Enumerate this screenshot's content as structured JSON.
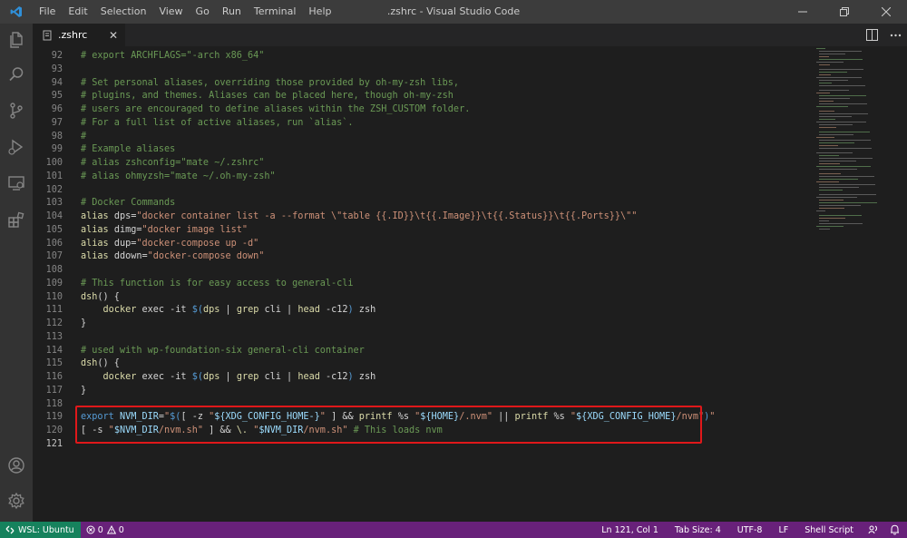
{
  "titlebar": {
    "menu": [
      "File",
      "Edit",
      "Selection",
      "View",
      "Go",
      "Run",
      "Terminal",
      "Help"
    ],
    "title": ".zshrc - Visual Studio Code"
  },
  "activity_icons": [
    "files-icon",
    "search-icon",
    "source-control-icon",
    "run-debug-icon",
    "remote-explorer-icon",
    "extensions-icon",
    "account-icon",
    "settings-gear-icon"
  ],
  "tab": {
    "label": ".zshrc"
  },
  "code": {
    "lines": [
      {
        "n": "92",
        "tokens": [
          {
            "t": "# export ARCHFLAGS=\"-arch x86_64\"",
            "c": "comment"
          }
        ]
      },
      {
        "n": "93",
        "tokens": []
      },
      {
        "n": "94",
        "tokens": [
          {
            "t": "# Set personal aliases, overriding those provided by oh-my-zsh libs,",
            "c": "comment"
          }
        ]
      },
      {
        "n": "95",
        "tokens": [
          {
            "t": "# plugins, and themes. Aliases can be placed here, though oh-my-zsh",
            "c": "comment"
          }
        ]
      },
      {
        "n": "96",
        "tokens": [
          {
            "t": "# users are encouraged to define aliases within the ZSH_CUSTOM folder.",
            "c": "comment"
          }
        ]
      },
      {
        "n": "97",
        "tokens": [
          {
            "t": "# For a full list of active aliases, run `alias`.",
            "c": "comment"
          }
        ]
      },
      {
        "n": "98",
        "tokens": [
          {
            "t": "#",
            "c": "comment"
          }
        ]
      },
      {
        "n": "99",
        "tokens": [
          {
            "t": "# Example aliases",
            "c": "comment"
          }
        ]
      },
      {
        "n": "100",
        "tokens": [
          {
            "t": "# alias zshconfig=\"mate ~/.zshrc\"",
            "c": "comment"
          }
        ]
      },
      {
        "n": "101",
        "tokens": [
          {
            "t": "# alias ohmyzsh=\"mate ~/.oh-my-zsh\"",
            "c": "comment"
          }
        ]
      },
      {
        "n": "102",
        "tokens": []
      },
      {
        "n": "103",
        "tokens": [
          {
            "t": "# Docker Commands",
            "c": "comment"
          }
        ]
      },
      {
        "n": "104",
        "tokens": [
          {
            "t": "alias ",
            "c": "func"
          },
          {
            "t": "dps",
            "c": "plain"
          },
          {
            "t": "=",
            "c": "op"
          },
          {
            "t": "\"docker container list -a --format \\\"table {{.ID}}\\t{{.Image}}\\t{{.Status}}\\t{{.Ports}}\\\"\"",
            "c": "str"
          }
        ]
      },
      {
        "n": "105",
        "tokens": [
          {
            "t": "alias ",
            "c": "func"
          },
          {
            "t": "dimg",
            "c": "plain"
          },
          {
            "t": "=",
            "c": "op"
          },
          {
            "t": "\"docker image list\"",
            "c": "str"
          }
        ]
      },
      {
        "n": "106",
        "tokens": [
          {
            "t": "alias ",
            "c": "func"
          },
          {
            "t": "dup",
            "c": "plain"
          },
          {
            "t": "=",
            "c": "op"
          },
          {
            "t": "\"docker-compose up -d\"",
            "c": "str"
          }
        ]
      },
      {
        "n": "107",
        "tokens": [
          {
            "t": "alias ",
            "c": "func"
          },
          {
            "t": "ddown",
            "c": "plain"
          },
          {
            "t": "=",
            "c": "op"
          },
          {
            "t": "\"docker-compose down\"",
            "c": "str"
          }
        ]
      },
      {
        "n": "108",
        "tokens": []
      },
      {
        "n": "109",
        "tokens": [
          {
            "t": "# This function is for easy access to general-cli",
            "c": "comment"
          }
        ]
      },
      {
        "n": "110",
        "tokens": [
          {
            "t": "dsh",
            "c": "func"
          },
          {
            "t": "() {",
            "c": "plain"
          }
        ]
      },
      {
        "n": "111",
        "tokens": [
          {
            "t": "    ",
            "c": "plain"
          },
          {
            "t": "docker",
            "c": "func"
          },
          {
            "t": " exec -it ",
            "c": "plain"
          },
          {
            "t": "$(",
            "c": "kw"
          },
          {
            "t": "dps ",
            "c": "func"
          },
          {
            "t": "| ",
            "c": "plain"
          },
          {
            "t": "grep",
            "c": "func"
          },
          {
            "t": " cli ",
            "c": "plain"
          },
          {
            "t": "| ",
            "c": "plain"
          },
          {
            "t": "head",
            "c": "func"
          },
          {
            "t": " -c12",
            "c": "plain"
          },
          {
            "t": ")",
            "c": "kw"
          },
          {
            "t": " zsh",
            "c": "plain"
          }
        ]
      },
      {
        "n": "112",
        "tokens": [
          {
            "t": "}",
            "c": "plain"
          }
        ]
      },
      {
        "n": "113",
        "tokens": []
      },
      {
        "n": "114",
        "tokens": [
          {
            "t": "# used with wp-foundation-six general-cli container",
            "c": "comment"
          }
        ]
      },
      {
        "n": "115",
        "tokens": [
          {
            "t": "dsh",
            "c": "func"
          },
          {
            "t": "() {",
            "c": "plain"
          }
        ]
      },
      {
        "n": "116",
        "tokens": [
          {
            "t": "    ",
            "c": "plain"
          },
          {
            "t": "docker",
            "c": "func"
          },
          {
            "t": " exec -it ",
            "c": "plain"
          },
          {
            "t": "$(",
            "c": "kw"
          },
          {
            "t": "dps ",
            "c": "func"
          },
          {
            "t": "| ",
            "c": "plain"
          },
          {
            "t": "grep",
            "c": "func"
          },
          {
            "t": " cli ",
            "c": "plain"
          },
          {
            "t": "| ",
            "c": "plain"
          },
          {
            "t": "head",
            "c": "func"
          },
          {
            "t": " -c12",
            "c": "plain"
          },
          {
            "t": ")",
            "c": "kw"
          },
          {
            "t": " zsh",
            "c": "plain"
          }
        ]
      },
      {
        "n": "117",
        "tokens": [
          {
            "t": "}",
            "c": "plain"
          }
        ]
      },
      {
        "n": "118",
        "tokens": []
      },
      {
        "n": "119",
        "tokens": [
          {
            "t": "export ",
            "c": "kw"
          },
          {
            "t": "NVM_DIR",
            "c": "var"
          },
          {
            "t": "=",
            "c": "op"
          },
          {
            "t": "\"",
            "c": "str"
          },
          {
            "t": "$(",
            "c": "kw"
          },
          {
            "t": "[ -z ",
            "c": "plain"
          },
          {
            "t": "\"",
            "c": "str"
          },
          {
            "t": "${XDG_CONFIG_HOME-}",
            "c": "var"
          },
          {
            "t": "\"",
            "c": "str"
          },
          {
            "t": " ] && ",
            "c": "plain"
          },
          {
            "t": "printf",
            "c": "func"
          },
          {
            "t": " %s ",
            "c": "plain"
          },
          {
            "t": "\"",
            "c": "str"
          },
          {
            "t": "${HOME}",
            "c": "var"
          },
          {
            "t": "/.nvm\"",
            "c": "str"
          },
          {
            "t": " || ",
            "c": "plain"
          },
          {
            "t": "printf",
            "c": "func"
          },
          {
            "t": " %s ",
            "c": "plain"
          },
          {
            "t": "\"",
            "c": "str"
          },
          {
            "t": "${XDG_CONFIG_HOME}",
            "c": "var"
          },
          {
            "t": "/nvm\"",
            "c": "str"
          },
          {
            "t": ")",
            "c": "kw"
          },
          {
            "t": "\"",
            "c": "str"
          }
        ]
      },
      {
        "n": "120",
        "tokens": [
          {
            "t": "[ -s ",
            "c": "plain"
          },
          {
            "t": "\"",
            "c": "str"
          },
          {
            "t": "$NVM_DIR",
            "c": "var"
          },
          {
            "t": "/nvm.sh\"",
            "c": "str"
          },
          {
            "t": " ] && ",
            "c": "plain"
          },
          {
            "t": "\\. ",
            "c": "func"
          },
          {
            "t": "\"",
            "c": "str"
          },
          {
            "t": "$NVM_DIR",
            "c": "var"
          },
          {
            "t": "/nvm.sh\"",
            "c": "str"
          },
          {
            "t": " ",
            "c": "plain"
          },
          {
            "t": "# This loads nvm",
            "c": "comment"
          }
        ]
      },
      {
        "n": "121",
        "tokens": [],
        "active": true
      }
    ]
  },
  "statusbar": {
    "remote": "WSL: Ubuntu",
    "errors": "0",
    "warnings": "0",
    "position": "Ln 121, Col 1",
    "tab_size": "Tab Size: 4",
    "encoding": "UTF-8",
    "eol": "LF",
    "language": "Shell Script"
  },
  "colors": {
    "statusbar": "#68217a",
    "remote": "#16825d",
    "highlight": "#e0181a"
  }
}
